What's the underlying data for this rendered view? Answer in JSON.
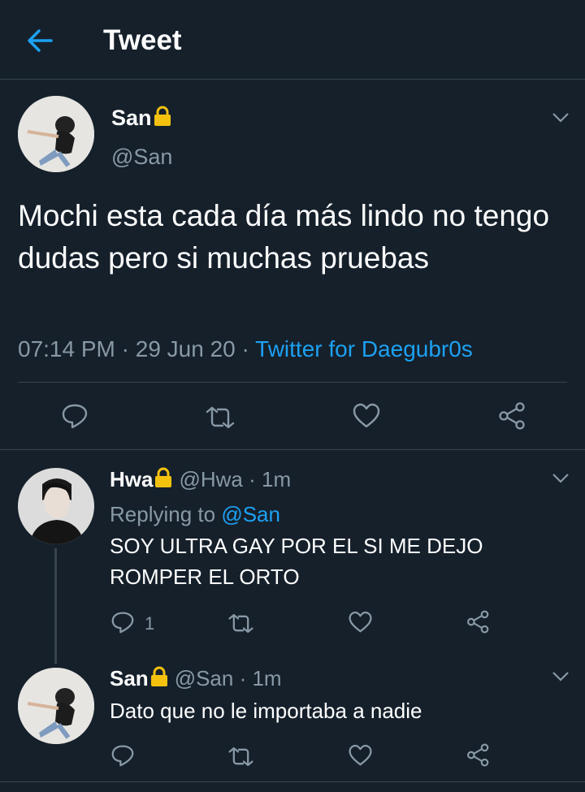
{
  "header": {
    "title": "Tweet"
  },
  "main_tweet": {
    "author_name": "San",
    "author_handle": "@San",
    "text": "Mochi esta cada día más lindo no tengo dudas pero si muchas pruebas",
    "time": "07:14 PM",
    "date": "29 Jun 20",
    "source": "Twitter for Daegubr0s",
    "meta_separator": " · "
  },
  "replies": [
    {
      "author_name": "Hwa",
      "author_handle": "@Hwa",
      "time_ago": "· 1m",
      "replying_label": "Replying to",
      "replying_to": "@San",
      "text_line1": "SOY ULTRA GAY POR EL SI ME DEJO",
      "text_line2": "ROMPER EL ORTO",
      "reply_count": "1"
    },
    {
      "author_name": "San",
      "author_handle": "@San",
      "time_ago": "· 1m",
      "text_line1": "Dato que no le importaba a nadie"
    }
  ],
  "colors": {
    "background": "#15202b",
    "accent": "#1da1f2",
    "secondary_text": "#8899a6",
    "divider": "#38444d",
    "lock": "#f4c20d"
  },
  "icons": [
    "back-arrow-icon",
    "lock-icon",
    "chevron-down-icon",
    "reply-icon",
    "retweet-icon",
    "like-icon",
    "share-icon"
  ]
}
